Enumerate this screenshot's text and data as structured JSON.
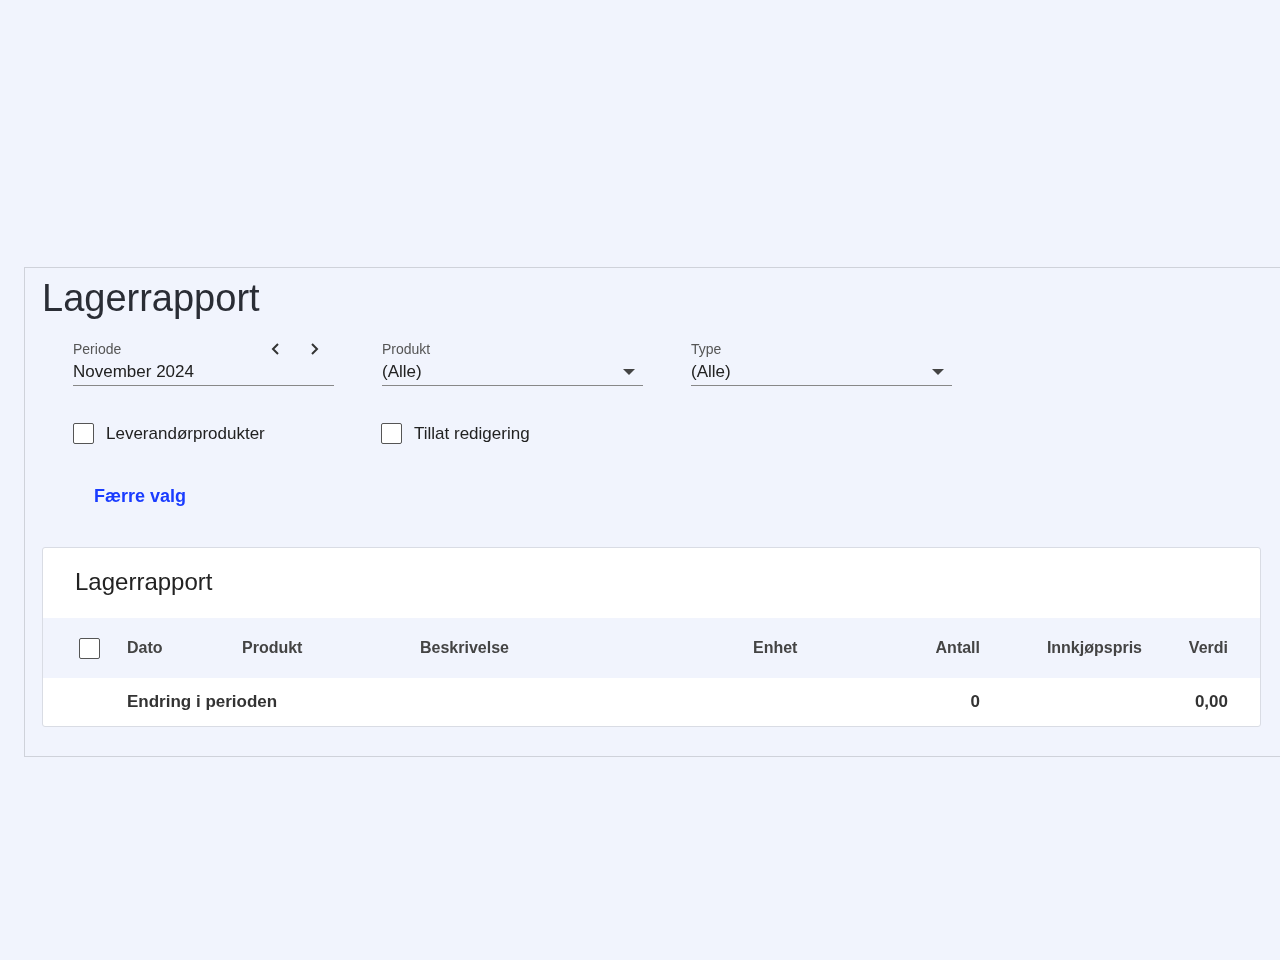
{
  "page_title": "Lagerrapport",
  "filters": [
    {
      "kind": "period",
      "label": "Periode",
      "value": "November 2024"
    },
    {
      "kind": "select",
      "label": "Produkt",
      "value": "(Alle)"
    },
    {
      "kind": "select",
      "label": "Type",
      "value": "(Alle)"
    }
  ],
  "checkboxes": [
    {
      "label": "Leverandørprodukter",
      "checked": false
    },
    {
      "label": "Tillat redigering",
      "checked": false
    }
  ],
  "toggle_link": "Færre valg",
  "report": {
    "title": "Lagerrapport",
    "select_all_checked": false,
    "columns": [
      "Dato",
      "Produkt",
      "Beskrivelse",
      "Enhet",
      "Antall",
      "Innkjøpspris",
      "Verdi"
    ],
    "rows": [
      {
        "label": "Endring i perioden",
        "antall": "0",
        "verdi": "0,00"
      }
    ]
  }
}
